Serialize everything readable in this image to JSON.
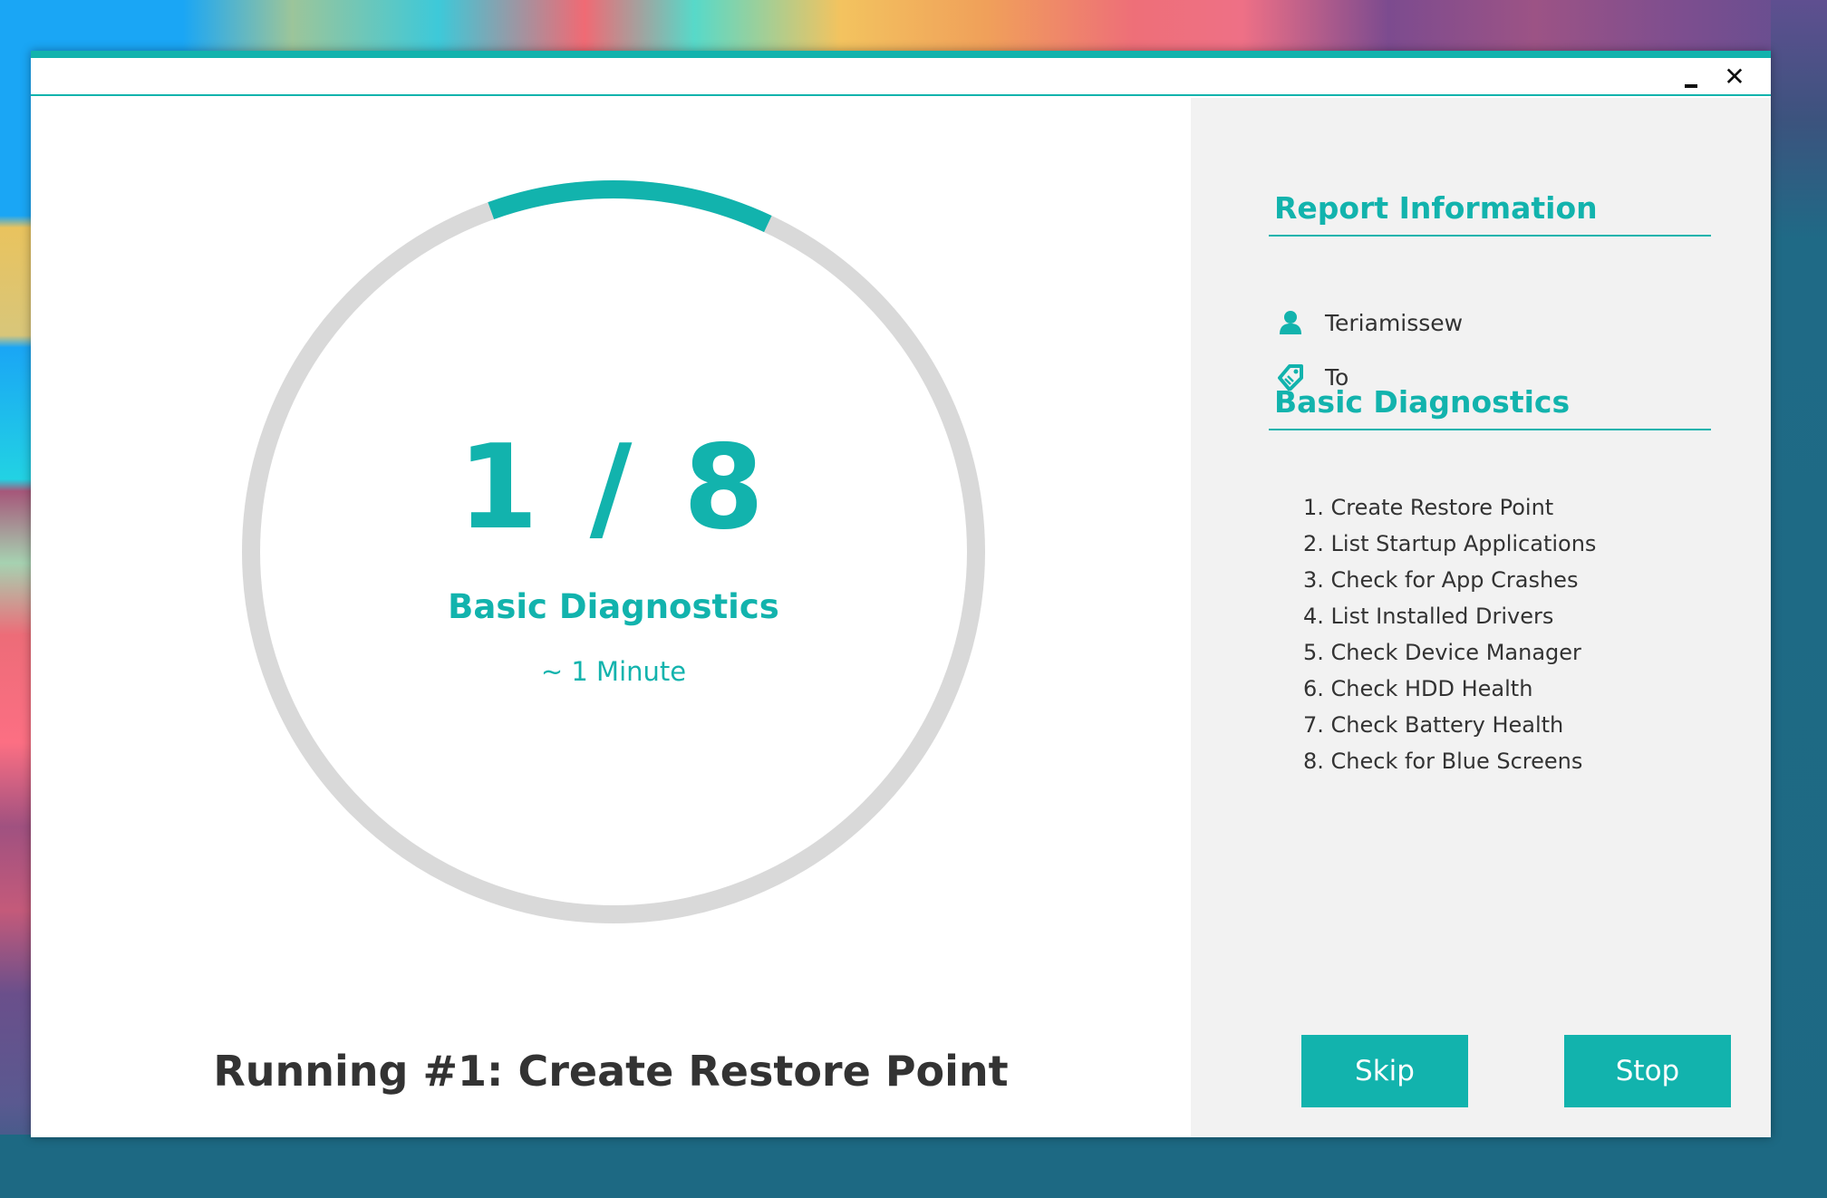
{
  "window": {
    "controls": {
      "minimize_icon": "minimize-icon",
      "close_icon": "close-icon",
      "close_glyph": "✕"
    },
    "accent_color": "#12b3ad"
  },
  "progress": {
    "current": "1",
    "separator": "/",
    "total": "8",
    "display": "1 / 8",
    "fraction_complete": 0.125,
    "title": "Basic Diagnostics",
    "estimate": "~ 1 Minute",
    "ring_color": "#12b3ad",
    "track_color": "#d9d9d9"
  },
  "status": {
    "running_text": "Running #1: Create Restore Point"
  },
  "sidebar": {
    "report_heading": "Report Information",
    "user": {
      "icon": "user-icon",
      "value": "Teriamissew"
    },
    "tag": {
      "icon": "tag-icon",
      "value": "To"
    },
    "diagnostics_heading": "Basic Diagnostics",
    "steps": [
      "1. Create Restore Point",
      "2. List Startup Applications",
      "3. Check for App Crashes",
      "4. List Installed Drivers",
      "5. Check Device Manager",
      "6. Check HDD Health",
      "7. Check Battery Health",
      "8. Check for Blue Screens"
    ]
  },
  "actions": {
    "skip_label": "Skip",
    "stop_label": "Stop"
  }
}
